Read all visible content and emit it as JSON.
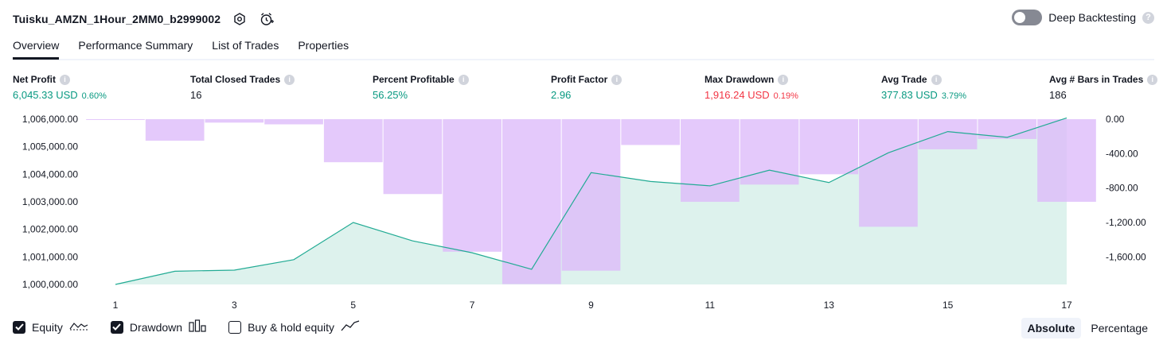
{
  "strategy": {
    "title": "Tuisku_AMZN_1Hour_2MM0_b2999002"
  },
  "header": {
    "icons": [
      "settings-icon",
      "alert-clock-icon"
    ]
  },
  "deep_backtesting": {
    "label": "Deep Backtesting",
    "enabled": false
  },
  "tabs": [
    {
      "label": "Overview",
      "active": true
    },
    {
      "label": "Performance Summary",
      "active": false
    },
    {
      "label": "List of Trades",
      "active": false
    },
    {
      "label": "Properties",
      "active": false
    }
  ],
  "metrics": {
    "net_profit": {
      "label": "Net Profit",
      "value": "6,045.33 USD",
      "sub": "0.60%"
    },
    "total_closed_trades": {
      "label": "Total Closed Trades",
      "value": "16"
    },
    "percent_profitable": {
      "label": "Percent Profitable",
      "value": "56.25%"
    },
    "profit_factor": {
      "label": "Profit Factor",
      "value": "2.96"
    },
    "max_drawdown": {
      "label": "Max Drawdown",
      "value": "1,916.24 USD",
      "sub": "0.19%"
    },
    "avg_trade": {
      "label": "Avg Trade",
      "value": "377.83 USD",
      "sub": "3.79%"
    },
    "avg_bars": {
      "label": "Avg # Bars in Trades",
      "value": "186"
    }
  },
  "colors": {
    "positive": "#089981",
    "negative": "#f23645",
    "equity_line": "#22ab94",
    "equity_fill": "#d7f0ea",
    "drawdown_bar": "#dcbafa"
  },
  "chart_data": {
    "type": "area",
    "x": [
      1,
      2,
      3,
      4,
      5,
      6,
      7,
      8,
      9,
      10,
      11,
      12,
      13,
      14,
      15,
      16,
      17
    ],
    "x_ticks": [
      "1",
      "3",
      "5",
      "7",
      "9",
      "11",
      "13",
      "15",
      "17"
    ],
    "left_axis_ticks": [
      "1,006,000.00",
      "1,005,000.00",
      "1,004,000.00",
      "1,003,000.00",
      "1,002,000.00",
      "1,001,000.00",
      "1,000,000.00"
    ],
    "right_axis_ticks": [
      "0.00",
      "-400.00",
      "-800.00",
      "-1,200.00",
      "-1,600.00"
    ],
    "ylim_left": [
      1000000,
      1006000
    ],
    "ylim_right": [
      -1920,
      0
    ],
    "series": [
      {
        "kind": "equity",
        "axis": "left",
        "values": [
          1000000,
          1000480,
          1000520,
          1000900,
          1002250,
          1001580,
          1001150,
          1000550,
          1004060,
          1003740,
          1003580,
          1004150,
          1003700,
          1004780,
          1005550,
          1005340,
          1006045
        ]
      },
      {
        "kind": "drawdown",
        "axis": "right",
        "values": [
          0,
          -250,
          -40,
          -60,
          -500,
          -870,
          -1540,
          -1916,
          -1760,
          -300,
          -960,
          -760,
          -640,
          -1250,
          -350,
          -230,
          -960
        ]
      }
    ]
  },
  "legend": {
    "items": [
      {
        "label": "Equity",
        "checked": true,
        "icon": "equity-line-icon"
      },
      {
        "label": "Drawdown",
        "checked": true,
        "icon": "drawdown-bars-icon"
      },
      {
        "label": "Buy & hold equity",
        "checked": false,
        "icon": "buy-hold-line-icon"
      }
    ]
  },
  "modes": [
    {
      "label": "Absolute",
      "active": true
    },
    {
      "label": "Percentage",
      "active": false
    }
  ]
}
